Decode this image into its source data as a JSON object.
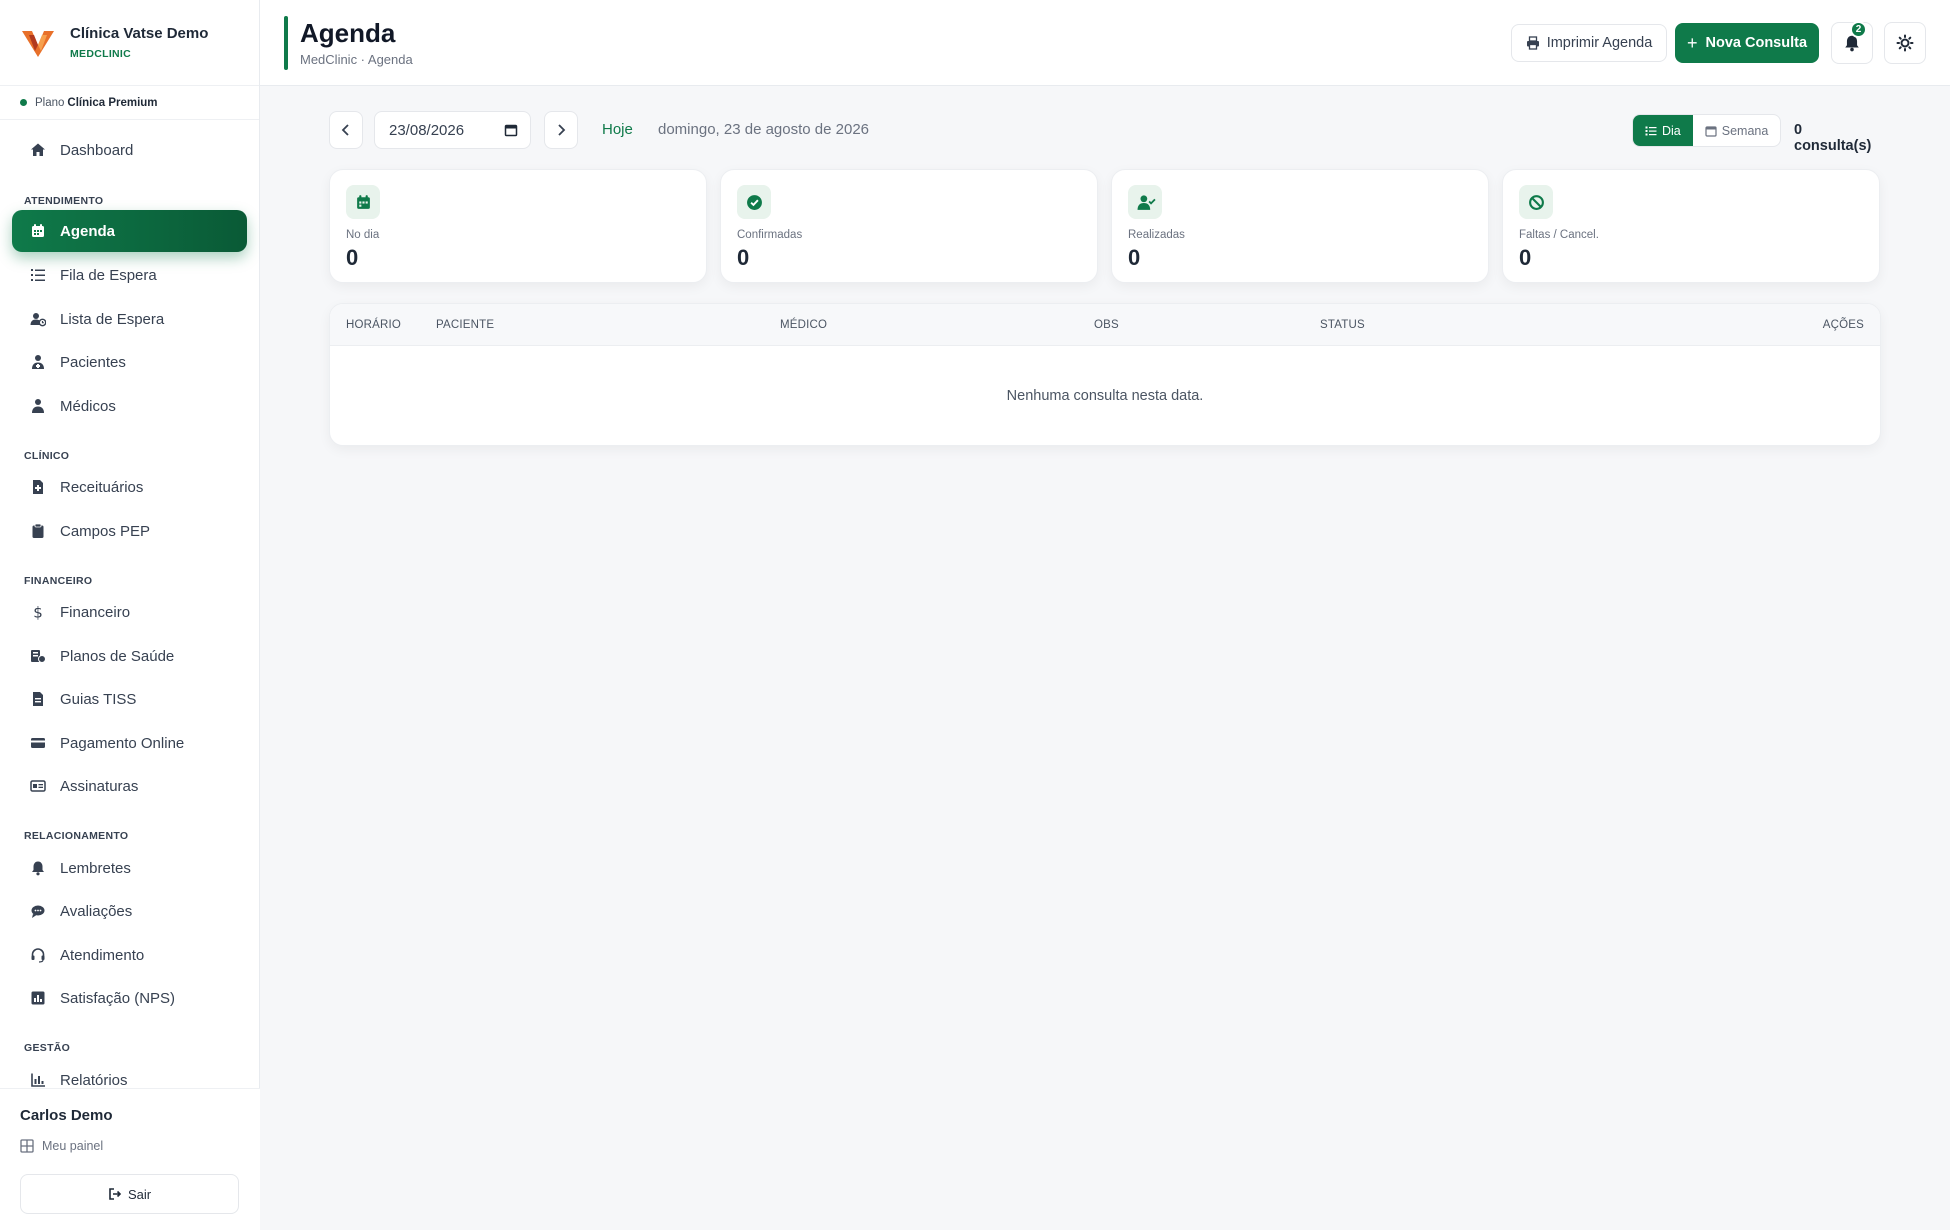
{
  "brand": {
    "name": "Clínica Vatse Demo",
    "subtitle": "MEDCLINIC"
  },
  "plan": {
    "prefix": "Plano",
    "name": "Clínica Premium"
  },
  "sidebar": {
    "sections": {
      "atendimento": "ATENDIMENTO",
      "clinico": "CLÍNICO",
      "financeiro": "FINANCEIRO",
      "relacionamento": "RELACIONAMENTO",
      "gestao": "GESTÃO"
    },
    "items": {
      "dashboard": "Dashboard",
      "agenda": "Agenda",
      "fila": "Fila de Espera",
      "lista": "Lista de Espera",
      "pacientes": "Pacientes",
      "medicos": "Médicos",
      "receituarios": "Receituários",
      "campos_pep": "Campos PEP",
      "financeiro": "Financeiro",
      "planos": "Planos de Saúde",
      "guias": "Guias TISS",
      "pagamento": "Pagamento Online",
      "assinaturas": "Assinaturas",
      "lembretes": "Lembretes",
      "avaliacoes": "Avaliações",
      "atendimento": "Atendimento",
      "satisfacao": "Satisfação (NPS)",
      "relatorios": "Relatórios"
    },
    "active": "agenda"
  },
  "user": {
    "name": "Carlos Demo",
    "panel_label": "Meu painel",
    "logout_label": "Sair"
  },
  "header": {
    "title": "Agenda",
    "breadcrumb": "MedClinic · Agenda",
    "print_label": "Imprimir Agenda",
    "new_label": "Nova Consulta",
    "notifications_count": "2"
  },
  "toolbar": {
    "date_value": "23/08/2026",
    "today_label": "Hoje",
    "long_date": "domingo, 23 de agosto de 2026",
    "view_day": "Dia",
    "view_week": "Semana",
    "active_view": "Dia",
    "count_label": "0 consulta(s)"
  },
  "stats": [
    {
      "label": "No dia",
      "value": "0",
      "icon": "calendar-icon"
    },
    {
      "label": "Confirmadas",
      "value": "0",
      "icon": "check-circle-icon"
    },
    {
      "label": "Realizadas",
      "value": "0",
      "icon": "user-check-icon"
    },
    {
      "label": "Faltas / Cancel.",
      "value": "0",
      "icon": "ban-icon"
    }
  ],
  "table": {
    "columns": [
      "HORÁRIO",
      "PACIENTE",
      "MÉDICO",
      "OBS",
      "STATUS",
      "AÇÕES"
    ],
    "empty_message": "Nenhuma consulta nesta data."
  },
  "colors": {
    "accent": "#0f7a4a",
    "logo_primary": "#e8702a",
    "logo_secondary": "#b23a1e"
  }
}
